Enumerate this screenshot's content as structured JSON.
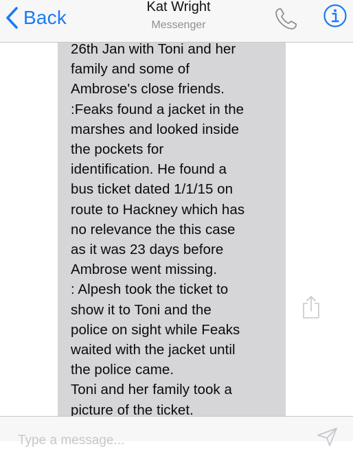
{
  "header": {
    "back_label": "Back",
    "title": "Kat Wright",
    "subtitle": "Messenger",
    "accent_color": "#1a7cf5",
    "icons": {
      "back": "chevron-left-icon",
      "phone": "phone-icon",
      "info": "info-circle-icon"
    }
  },
  "message": {
    "bubble_color": "#d6d6d8",
    "lines": [
      "26th Jan with Toni and her",
      "family and some of",
      "Ambrose's close friends.",
      ":Feaks found a jacket in the",
      "marshes and looked inside",
      "the pockets for",
      "identification. He found a",
      "bus ticket dated 1/1/15 on",
      "route to Hackney which has",
      "no relevance the this case",
      "as it was 23 days before",
      "Ambrose went missing.",
      ": Alpesh took the ticket to",
      "show it to Toni and the",
      "police on sight while Feaks",
      "waited with the jacket until",
      "the police came.",
      "Toni and her family took a",
      "picture of the ticket."
    ],
    "share_icon": "share-icon"
  },
  "composer": {
    "placeholder": "Type a message...",
    "value": "",
    "send_icon": "send-icon"
  }
}
